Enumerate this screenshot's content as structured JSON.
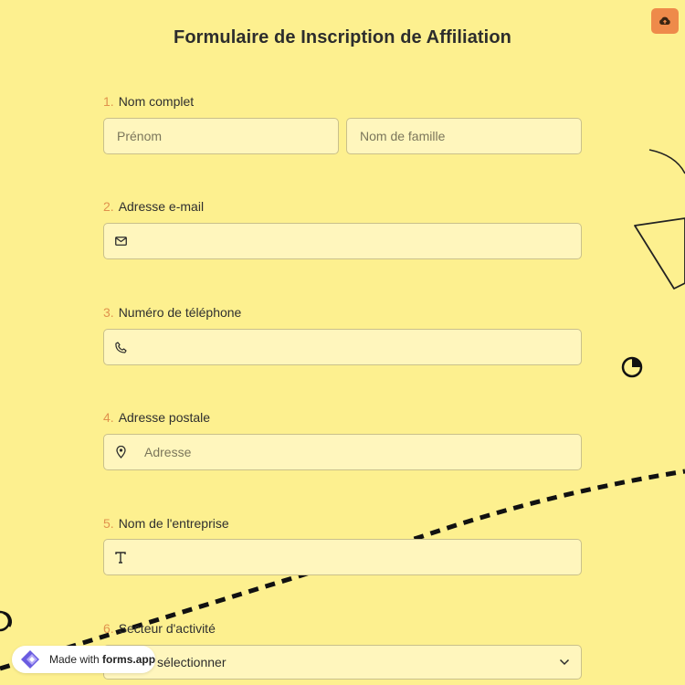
{
  "toolbar": {
    "save_icon": "cloud-upload-icon",
    "accent": "#ee8a4a"
  },
  "form": {
    "title": "Formulaire de Inscription de Affiliation",
    "questions": [
      {
        "num": "1.",
        "label": "Nom complet",
        "fields": [
          {
            "placeholder": "Prénom"
          },
          {
            "placeholder": "Nom de famille"
          }
        ]
      },
      {
        "num": "2.",
        "label": "Adresse e-mail",
        "icon": "mail-icon",
        "value": ""
      },
      {
        "num": "3.",
        "label": "Numéro de téléphone",
        "icon": "phone-icon",
        "value": ""
      },
      {
        "num": "4.",
        "label": "Adresse postale",
        "icon": "location-pin-icon",
        "placeholder": "Adresse"
      },
      {
        "num": "5.",
        "label": "Nom de l'entreprise",
        "icon": "text-icon",
        "value": ""
      },
      {
        "num": "6.",
        "label": "Secteur d'activité",
        "select_text": "sélectionner",
        "icon": "chevron-down-icon"
      }
    ]
  },
  "badge": {
    "prefix": "Made with",
    "brand": "forms.app"
  },
  "colors": {
    "background": "#fdf08f",
    "field_bg": "#fff6bd",
    "number_color": "#e0924d"
  }
}
